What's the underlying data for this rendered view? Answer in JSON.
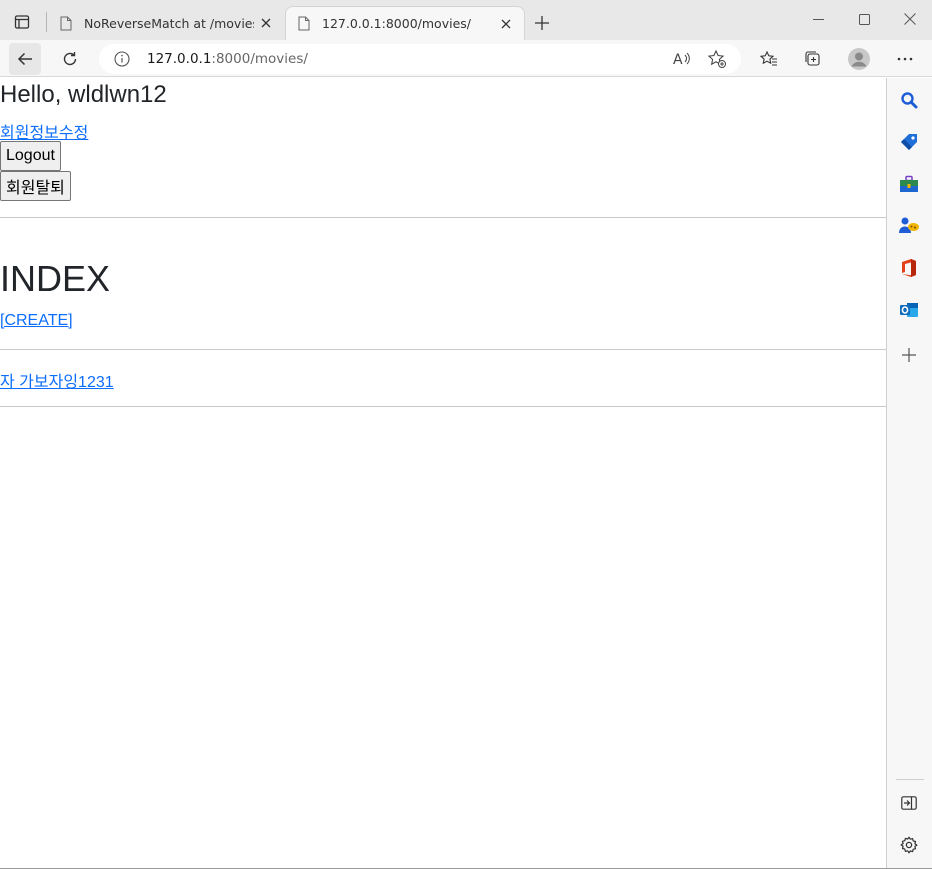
{
  "browser": {
    "tabs": [
      {
        "title": "NoReverseMatch at /movies/",
        "active": false
      },
      {
        "title": "127.0.0.1:8000/movies/",
        "active": true
      }
    ],
    "address": {
      "host": "127.0.0.1",
      "path": ":8000/movies/"
    }
  },
  "page": {
    "greeting": "Hello, wldlwn12",
    "profile_link": "회원정보수정",
    "logout_button": "Logout",
    "withdraw_button": "회원탈퇴",
    "index_title": "INDEX",
    "create_link": "[CREATE]",
    "movies": [
      "자 가보자잉1231"
    ]
  },
  "colors": {
    "link": "#0d6efd",
    "text": "#212529",
    "chrome_bg": "#f7f7f7",
    "tabstrip_bg": "#e8e8e8"
  },
  "icons": {
    "sidebar": [
      "search-icon",
      "tag-icon",
      "toolbox-icon",
      "games-icon",
      "office-icon",
      "outlook-icon",
      "add-icon",
      "hide-sidebar-icon",
      "settings-gear-icon"
    ]
  }
}
